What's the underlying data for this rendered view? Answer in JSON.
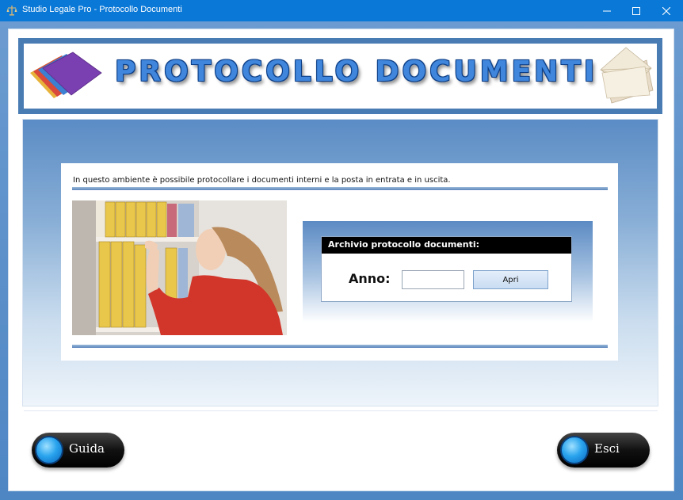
{
  "window": {
    "title": "Studio Legale Pro - Protocollo Documenti"
  },
  "banner": {
    "title": "PROTOCOLLO DOCUMENTI"
  },
  "content": {
    "description": "In questo ambiente è possibile protocollare i documenti interni e la posta in entrata e in uscita."
  },
  "form": {
    "header": "Archivio protocollo documenti:",
    "anno_label": "Anno:",
    "anno_value": "",
    "apri_label": "Apri"
  },
  "footer": {
    "guida_label": "Guida",
    "esci_label": "Esci"
  },
  "icons": {
    "app": "scales-of-justice-icon",
    "minimize": "minimize-icon",
    "maximize": "maximize-icon",
    "close": "close-icon",
    "left_graphic": "colored-papers-icon",
    "right_graphic": "envelope-icon"
  },
  "colors": {
    "titlebar": "#0a78d7",
    "banner_border": "#4a7cb4",
    "banner_text": "#3f86dc",
    "accent_orb": "#2aa4ee"
  }
}
